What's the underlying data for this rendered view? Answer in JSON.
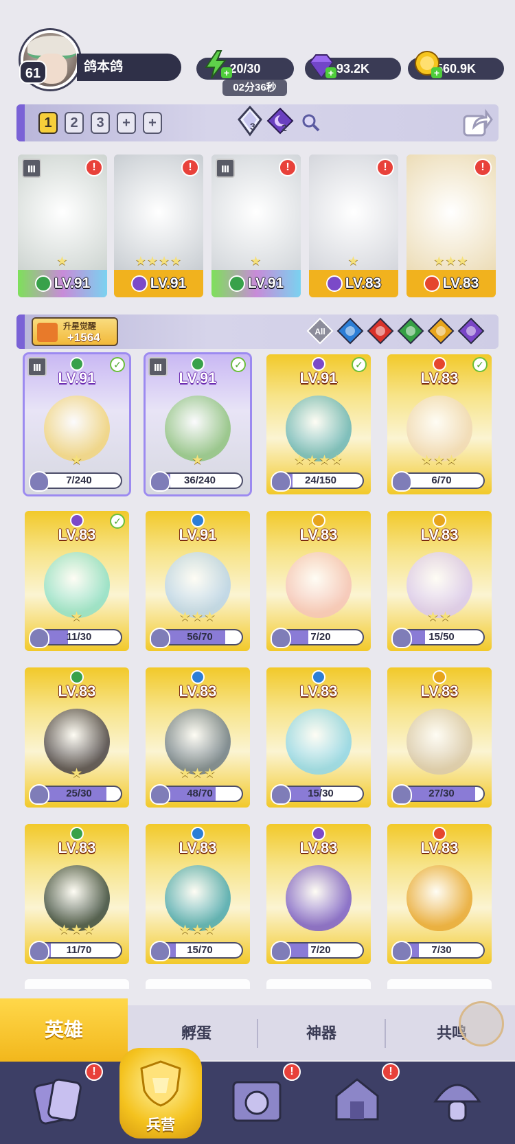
{
  "player": {
    "level": "61",
    "name": "鸽本鸽"
  },
  "resources": {
    "energy": "20/30",
    "energy_timer": "02分36秒",
    "gems": "93.2K",
    "gold": "560.9K"
  },
  "team_slots": [
    "1",
    "2",
    "3",
    "+",
    "+"
  ],
  "team_counters": {
    "crystal": "3",
    "moon": "2"
  },
  "team_heroes": [
    {
      "level": "LV.91",
      "stars": "★",
      "tier": "Ⅲ",
      "element": "#38a14a",
      "bg": "#cdd4d0",
      "foot": "linear-gradient(90deg,#7ee05a,#c88bd8,#7ad2f0)"
    },
    {
      "level": "LV.91",
      "stars": "★★★★",
      "tier": "",
      "element": "#7b4ac8",
      "bg": "#c8cdd2",
      "foot": "#f1b21e"
    },
    {
      "level": "LV.91",
      "stars": "★",
      "tier": "Ⅲ",
      "element": "#38a14a",
      "bg": "#d2d6da",
      "foot": "linear-gradient(90deg,#7ee05a,#c88bd8,#7ad2f0)"
    },
    {
      "level": "LV.83",
      "stars": "★",
      "tier": "",
      "element": "#7b4ac8",
      "bg": "#d4d6dc",
      "foot": "#f1b21e"
    },
    {
      "level": "LV.83",
      "stars": "★★★",
      "tier": "",
      "element": "#e5462e",
      "bg": "#ecdcb6",
      "foot": "#f1b21e"
    }
  ],
  "upstar": {
    "label": "升星觉醒",
    "value": "+1564"
  },
  "filter_all_label": "All",
  "filter_colors": [
    "#2c7ed6",
    "#d9332a",
    "#36a045",
    "#e7a51c",
    "#7a46c7"
  ],
  "heroes": [
    {
      "level": "LV.91",
      "progress": "7/240",
      "ratio": 0.03,
      "stars": "★",
      "element": "#38a14a",
      "checked": true,
      "selected": true,
      "tier": "Ⅲ",
      "bg": "#d8dce6",
      "hero": "#f2d57a"
    },
    {
      "level": "LV.91",
      "progress": "36/240",
      "ratio": 0.15,
      "stars": "★",
      "element": "#38a14a",
      "checked": true,
      "selected": true,
      "tier": "Ⅲ",
      "bg": "#d3d8d6",
      "hero": "#8fc37d"
    },
    {
      "level": "LV.91",
      "progress": "24/150",
      "ratio": 0.16,
      "stars": "★★★★",
      "element": "#7b4ac8",
      "checked": true,
      "selected": false,
      "tier": "",
      "bg": "#f2c92a",
      "hero": "#6ab6b8"
    },
    {
      "level": "LV.83",
      "progress": "6/70",
      "ratio": 0.09,
      "stars": "★★★",
      "element": "#e5462e",
      "checked": true,
      "selected": false,
      "tier": "",
      "bg": "#f2c92a",
      "hero": "#f0d9b4"
    },
    {
      "level": "LV.83",
      "progress": "11/30",
      "ratio": 0.37,
      "stars": "★",
      "element": "#7b4ac8",
      "checked": true,
      "selected": false,
      "tier": "",
      "bg": "#f2c92a",
      "hero": "#8fe0c8"
    },
    {
      "level": "LV.91",
      "progress": "56/70",
      "ratio": 0.8,
      "stars": "★★★",
      "element": "#2c7ed6",
      "checked": false,
      "selected": false,
      "tier": "",
      "bg": "#f2c92a",
      "hero": "#b9d4ea"
    },
    {
      "level": "LV.83",
      "progress": "7/20",
      "ratio": 0.35,
      "stars": "",
      "element": "#e7a51c",
      "checked": false,
      "selected": false,
      "tier": "",
      "bg": "#f2c92a",
      "hero": "#f5c4b8"
    },
    {
      "level": "LV.83",
      "progress": "15/50",
      "ratio": 0.3,
      "stars": "★★",
      "element": "#e7a51c",
      "checked": false,
      "selected": false,
      "tier": "",
      "bg": "#f2c92a",
      "hero": "#d9c8ee"
    },
    {
      "level": "LV.83",
      "progress": "25/30",
      "ratio": 0.83,
      "stars": "★",
      "element": "#38a14a",
      "checked": false,
      "selected": false,
      "tier": "",
      "bg": "#f2c92a",
      "hero": "#4a4448"
    },
    {
      "level": "LV.83",
      "progress": "48/70",
      "ratio": 0.69,
      "stars": "★★★",
      "element": "#2c7ed6",
      "checked": false,
      "selected": false,
      "tier": "",
      "bg": "#f2c92a",
      "hero": "#6e7d88"
    },
    {
      "level": "LV.83",
      "progress": "15/30",
      "ratio": 0.5,
      "stars": "",
      "element": "#2c7ed6",
      "checked": false,
      "selected": false,
      "tier": "",
      "bg": "#f2c92a",
      "hero": "#8fd6e8"
    },
    {
      "level": "LV.83",
      "progress": "27/30",
      "ratio": 0.9,
      "stars": "",
      "element": "#e7a51c",
      "checked": false,
      "selected": false,
      "tier": "",
      "bg": "#f2c92a",
      "hero": "#d8c8aa"
    },
    {
      "level": "LV.83",
      "progress": "11/70",
      "ratio": 0.16,
      "stars": "★★★",
      "element": "#38a14a",
      "checked": false,
      "selected": false,
      "tier": "",
      "bg": "#f2c92a",
      "hero": "#3a4a3e"
    },
    {
      "level": "LV.83",
      "progress": "15/70",
      "ratio": 0.21,
      "stars": "★★★",
      "element": "#2c7ed6",
      "checked": false,
      "selected": false,
      "tier": "",
      "bg": "#f2c92a",
      "hero": "#4aa8b0"
    },
    {
      "level": "LV.83",
      "progress": "7/20",
      "ratio": 0.35,
      "stars": "",
      "element": "#7b4ac8",
      "checked": false,
      "selected": false,
      "tier": "",
      "bg": "#f2c92a",
      "hero": "#7a5ec8"
    },
    {
      "level": "LV.83",
      "progress": "7/30",
      "ratio": 0.23,
      "stars": "",
      "element": "#e5462e",
      "checked": false,
      "selected": false,
      "tier": "",
      "bg": "#f2c92a",
      "hero": "#e8a832"
    }
  ],
  "tabs": {
    "hero": "英雄",
    "hatch": "孵蛋",
    "artifact": "神器",
    "resonance": "共鸣"
  },
  "nav": {
    "barracks": "兵营"
  }
}
